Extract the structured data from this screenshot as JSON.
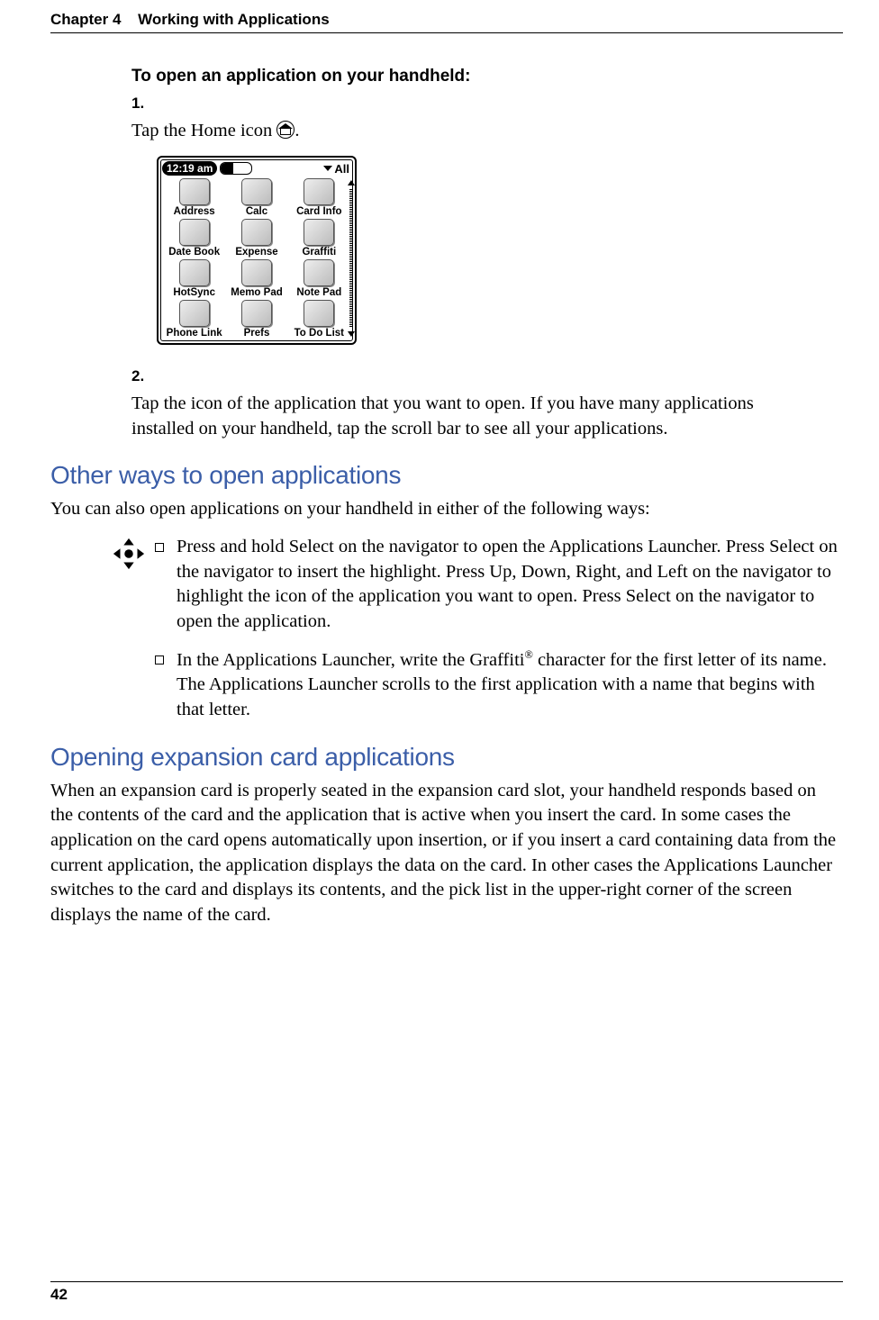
{
  "header": {
    "chapter": "Chapter 4",
    "title": "Working with Applications"
  },
  "proc": {
    "title": "To open an application on your handheld:",
    "step1": {
      "num": "1.",
      "text_before": "Tap the Home icon ",
      "text_after": "."
    },
    "step2": {
      "num": "2.",
      "text": "Tap the icon of the application that you want to open. If you have many applications installed on your handheld, tap the scroll bar to see all your applications."
    }
  },
  "device": {
    "time": "12:19 am",
    "category": "All",
    "apps": [
      "Address",
      "Calc",
      "Card Info",
      "Date Book",
      "Expense",
      "Graffiti",
      "HotSync",
      "Memo Pad",
      "Note Pad",
      "Phone Link",
      "Prefs",
      "To Do List"
    ]
  },
  "sections": {
    "other_ways": {
      "heading": "Other ways to open applications",
      "intro": "You can also open applications on your handheld in either of the following ways:",
      "bullet1": "Press and hold Select on the navigator to open the Applications Launcher. Press Select on the navigator to insert the highlight. Press Up, Down, Right, and Left on the navigator to highlight the icon of the application you want to open. Press Select on the navigator to open the application.",
      "bullet2_before": "In the Applications Launcher, write the Graffiti",
      "bullet2_after": " character for the first letter of its name. The Applications Launcher scrolls to the first application with a name that begins with that letter."
    },
    "expansion": {
      "heading": "Opening expansion card applications",
      "body": "When an expansion card is properly seated in the expansion card slot, your handheld responds based on the contents of the card and the application that is active when you insert the card. In some cases the application on the card opens automatically upon insertion, or if you insert a card containing data from the current application, the application displays the data on the card. In other cases the Applications Launcher switches to the card and displays its contents, and the pick list in the upper-right corner of the screen displays the name of the card."
    }
  },
  "footer": {
    "page": "42"
  }
}
